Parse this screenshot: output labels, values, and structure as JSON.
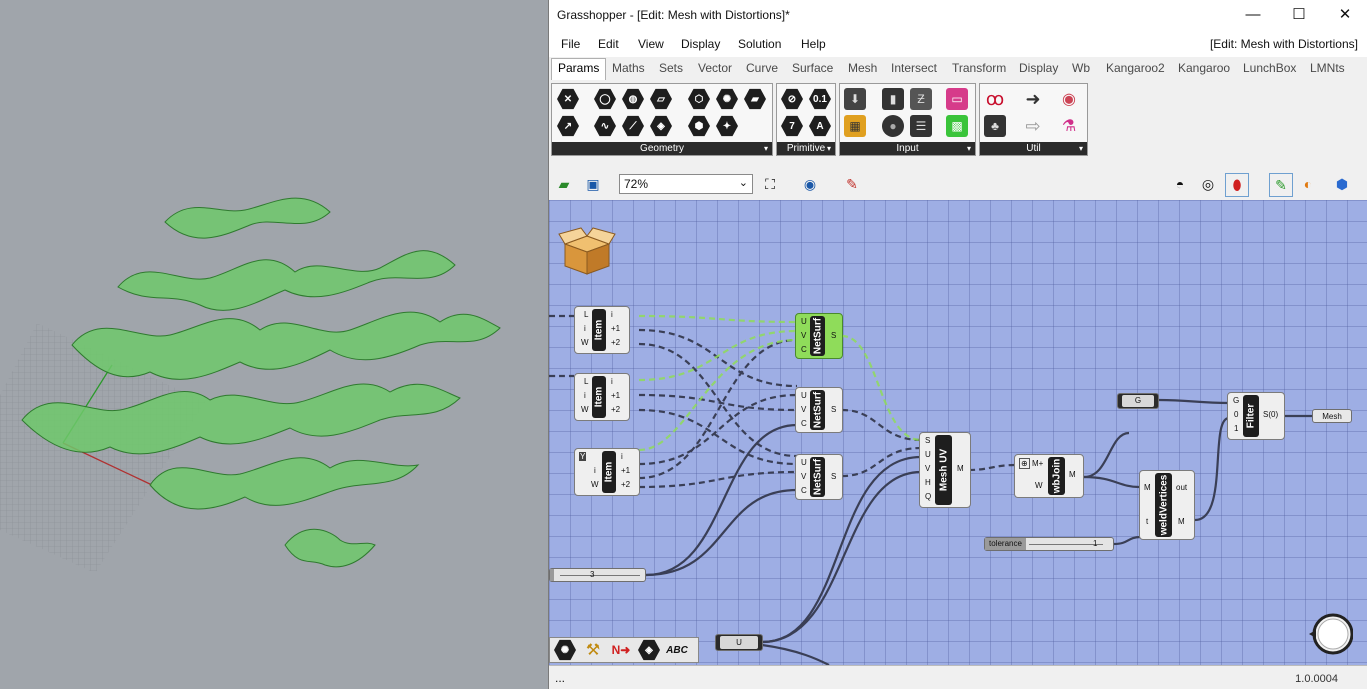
{
  "window": {
    "title": "Grasshopper - [Edit: Mesh with Distortions]*",
    "minimize": "—",
    "maximize": "☐",
    "close": "✕"
  },
  "menu": {
    "items": [
      "File",
      "Edit",
      "View",
      "Display",
      "Solution",
      "Help"
    ],
    "document_label": "[Edit: Mesh with Distortions]"
  },
  "tabs": [
    "Params",
    "Maths",
    "Sets",
    "Vector",
    "Curve",
    "Surface",
    "Mesh",
    "Intersect",
    "Transform",
    "Display",
    "Wb",
    "Kangaroo2",
    "Kangaroo",
    "LunchBox",
    "LMNts"
  ],
  "ribbon": {
    "panels": [
      "Geometry",
      "Primitive",
      "Input",
      "Util"
    ]
  },
  "toolbar": {
    "zoom": "72%"
  },
  "canvas": {
    "components": {
      "item1": {
        "name": "Item",
        "in": [
          "L",
          "i",
          "W"
        ],
        "out": [
          "i",
          "+1",
          "+2"
        ]
      },
      "item2": {
        "name": "Item",
        "in": [
          "L",
          "i",
          "W"
        ],
        "out": [
          "i",
          "+1",
          "+2"
        ]
      },
      "item3": {
        "name": "Item",
        "in": [
          "L",
          "i",
          "W"
        ],
        "out": [
          "i",
          "+1",
          "+2"
        ]
      },
      "netsurf1": {
        "name": "NetSurf",
        "in": [
          "U",
          "V",
          "C"
        ],
        "out": [
          "S"
        ]
      },
      "netsurf2": {
        "name": "NetSurf",
        "in": [
          "U",
          "V",
          "C"
        ],
        "out": [
          "S"
        ]
      },
      "netsurf3": {
        "name": "NetSurf",
        "in": [
          "U",
          "V",
          "C"
        ],
        "out": [
          "S"
        ]
      },
      "meshuv": {
        "name": "Mesh UV",
        "in": [
          "S",
          "U",
          "V",
          "H",
          "Q"
        ],
        "out": [
          "M"
        ]
      },
      "wbjoin": {
        "name": "wbJoin",
        "in": [
          "M+",
          "W"
        ],
        "out": [
          "M"
        ]
      },
      "weld": {
        "name": "weldVertices",
        "in": [
          "M",
          "t"
        ],
        "out": [
          "out",
          "M"
        ]
      },
      "filter": {
        "name": "Filter",
        "in": [
          "G",
          "0",
          "1"
        ],
        "out": [
          "S(0)"
        ]
      }
    },
    "params": {
      "g": "G",
      "mesh": "Mesh",
      "u": "U",
      "tolerance_label": "tolerance",
      "tolerance_value": "1",
      "slider_value": "3"
    },
    "status_left": "...",
    "version": "1.0.0004"
  }
}
